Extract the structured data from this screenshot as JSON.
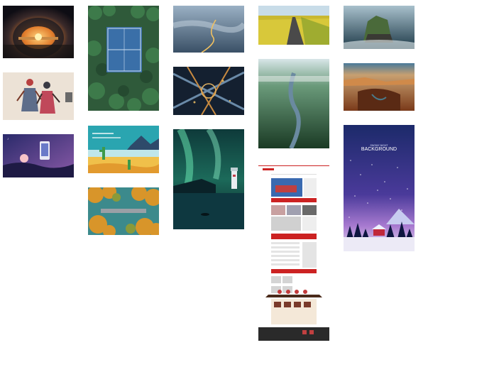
{
  "gallery": {
    "tiles": [
      {
        "id": "cave-sunset",
        "column": 1
      },
      {
        "id": "shadow-puppets",
        "column": 1
      },
      {
        "id": "phone-night-scene",
        "column": 1
      },
      {
        "id": "forest-court",
        "column": 2
      },
      {
        "id": "desert-cactus-illustration",
        "column": 2
      },
      {
        "id": "autumn-bridge",
        "column": 2
      },
      {
        "id": "misty-river",
        "column": 3
      },
      {
        "id": "highway-interchange",
        "column": 3
      },
      {
        "id": "aurora-lighthouse",
        "column": 3
      },
      {
        "id": "country-road-field",
        "column": 4
      },
      {
        "id": "forest-river",
        "column": 4
      },
      {
        "id": "website-mockup",
        "column": 4
      },
      {
        "id": "sea-stack-island",
        "column": 5
      },
      {
        "id": "canyon",
        "column": 5
      },
      {
        "id": "snowy-night-poster",
        "column": 5
      }
    ]
  },
  "poster": {
    "title": "BACKGROUND",
    "subtitle": "SNOWY NIGHT"
  }
}
